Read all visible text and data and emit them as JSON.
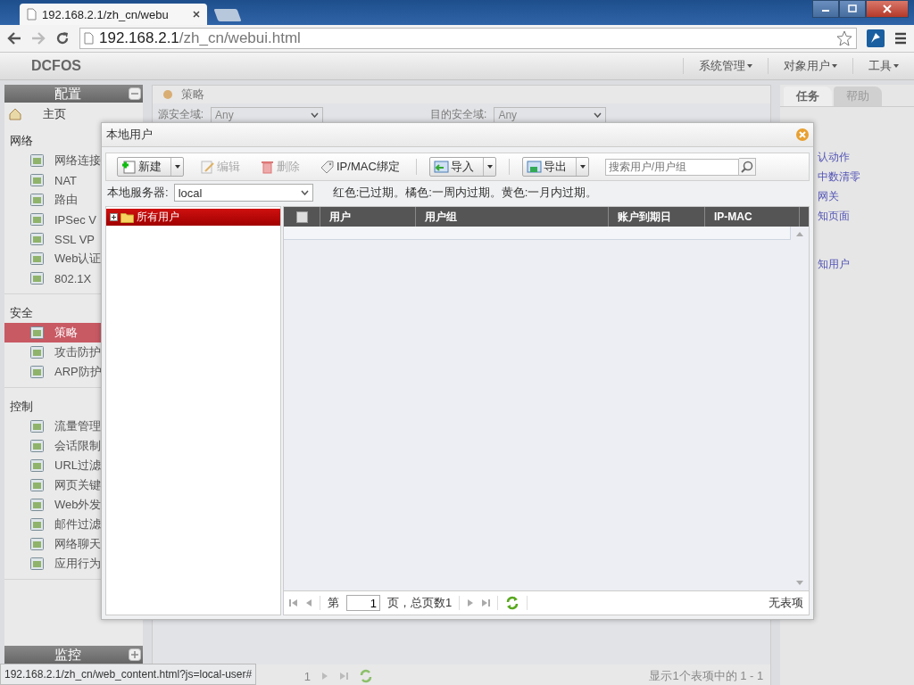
{
  "browser": {
    "tab_title": "192.168.2.1/zh_cn/webu",
    "url_host": "192.168.2.1",
    "url_path": "/zh_cn/webui.html"
  },
  "app": {
    "logo": "DCFOS",
    "menus": [
      "系统管理",
      "对象用户",
      "工具"
    ]
  },
  "sidebar": {
    "panels": [
      {
        "title": "配置",
        "expanded": true
      },
      {
        "title": "监控",
        "expanded": false
      }
    ],
    "home": "主页",
    "groups": [
      {
        "label": "网络",
        "items": [
          {
            "label": "网络连接",
            "selected": false
          },
          {
            "label": "NAT",
            "selected": false
          },
          {
            "label": "路由",
            "selected": false
          },
          {
            "label": "IPSec V",
            "selected": false
          },
          {
            "label": "SSL VP",
            "selected": false
          },
          {
            "label": "Web认证",
            "selected": false
          },
          {
            "label": "802.1X",
            "selected": false
          }
        ]
      },
      {
        "label": "安全",
        "items": [
          {
            "label": "策略",
            "selected": true
          },
          {
            "label": "攻击防护",
            "selected": false
          },
          {
            "label": "ARP防护",
            "selected": false
          }
        ]
      },
      {
        "label": "控制",
        "items": [
          {
            "label": "流量管理",
            "selected": false
          },
          {
            "label": "会话限制",
            "selected": false
          },
          {
            "label": "URL过滤",
            "selected": false
          },
          {
            "label": "网页关键",
            "selected": false
          },
          {
            "label": "Web外发",
            "selected": false
          },
          {
            "label": "邮件过滤",
            "selected": false
          },
          {
            "label": "网络聊天",
            "selected": false
          },
          {
            "label": "应用行为",
            "selected": false
          }
        ]
      }
    ]
  },
  "main": {
    "title": "策略",
    "fields": [
      {
        "label": "源安全域:",
        "value": "Any"
      },
      {
        "label": "目的安全域:",
        "value": "Any"
      }
    ],
    "pager_fragment": "1",
    "summary": "显示1个表项中的 1 - 1"
  },
  "right_panel": {
    "tabs": [
      {
        "label": "任务",
        "selected": true
      },
      {
        "label": "帮助",
        "selected": false
      }
    ],
    "links": [
      "认动作",
      "中数清零",
      "网关",
      "知页面",
      "知用户"
    ]
  },
  "dialog": {
    "title": "本地用户",
    "toolbar": [
      {
        "kind": "split",
        "label": "新建",
        "disabled": false
      },
      {
        "kind": "plain",
        "label": "编辑",
        "disabled": true
      },
      {
        "kind": "plain",
        "label": "删除",
        "disabled": true
      },
      {
        "kind": "plain",
        "label": "IP/MAC绑定",
        "disabled": false
      },
      {
        "kind": "split",
        "label": "导入",
        "disabled": false
      },
      {
        "kind": "split",
        "label": "导出",
        "disabled": false
      }
    ],
    "search_placeholder": "搜索用户/用户组",
    "server_label": "本地服务器:",
    "server_value": "local",
    "legend": "红色:已过期。橘色:一周内过期。黄色:一月内过期。",
    "tree": [
      {
        "label": "所有用户",
        "selected": true,
        "expanded": false
      }
    ],
    "columns": [
      "用户",
      "用户组",
      "账户到期日",
      "IP-MAC"
    ],
    "select_all_checked": false,
    "pager": {
      "before": "第",
      "page": "1",
      "after": "页，总页数1",
      "status": "无表项"
    }
  },
  "status_url": "192.168.2.1/zh_cn/web_content.html?js=local-user#"
}
